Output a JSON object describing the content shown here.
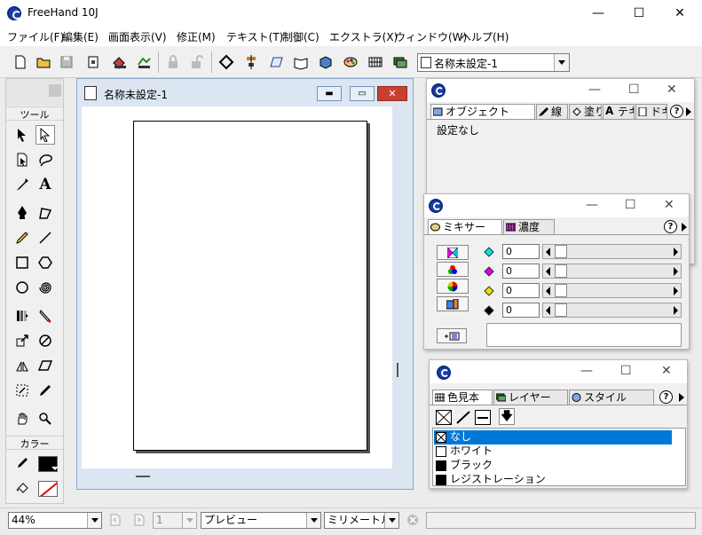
{
  "app": {
    "title": "FreeHand 10J"
  },
  "window_controls": {
    "minimize": "—",
    "maximize": "☐",
    "close": "✕"
  },
  "menu": [
    "ファイル(F)",
    "編集(E)",
    "画面表示(V)",
    "修正(M)",
    "テキスト(T)",
    "制御(C)",
    "エクストラ(X)",
    "ウィンドウ(W)",
    "ヘルプ(H)"
  ],
  "toolbar": {
    "document_selector": "名称未設定-1"
  },
  "tools_panel": {
    "tools_header": "ツール",
    "colors_header": "カラー"
  },
  "document_window": {
    "title": "名称未設定-1"
  },
  "object_palette": {
    "tabs": [
      "オブジェクト",
      "線",
      "塗り",
      "テキ",
      "ドキュ"
    ],
    "content": "設定なし",
    "help": "?"
  },
  "mixer_palette": {
    "tabs": [
      "ミキサー",
      "濃度"
    ],
    "help": "?",
    "rows": [
      {
        "color": "#00e5e5",
        "value": "0"
      },
      {
        "color": "#e000e0",
        "value": "0"
      },
      {
        "color": "#f0e000",
        "value": "0"
      },
      {
        "color": "#000000",
        "value": "0"
      }
    ]
  },
  "swatches_palette": {
    "tabs": [
      "色見本",
      "レイヤー",
      "スタイル"
    ],
    "help": "?",
    "items": [
      {
        "label": "なし",
        "selected": true
      },
      {
        "label": "ホワイト",
        "selected": false
      },
      {
        "label": "ブラック",
        "selected": false
      },
      {
        "label": "レジストレーション",
        "selected": false
      }
    ]
  },
  "status_bar": {
    "zoom": "44%",
    "page": "1",
    "view_mode": "プレビュー",
    "units": "ミリメートル"
  },
  "colors": {
    "accent": "#0078d7",
    "selection": "#0078d7"
  }
}
